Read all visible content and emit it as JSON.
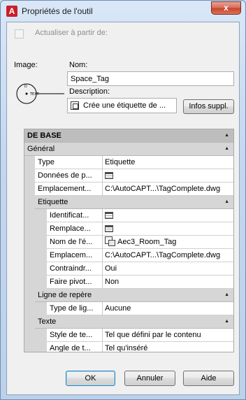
{
  "window": {
    "title": "Propriétés de l'outil",
    "app_icon_letter": "A",
    "close_glyph": "x"
  },
  "options": {
    "update_from_label": "Actualiser à partir de:",
    "update_from_checked": false
  },
  "image": {
    "label": "Image:",
    "preview_tag_letter": "D",
    "preview_text": "TEXT"
  },
  "name": {
    "label": "Nom:",
    "value": "Space_Tag"
  },
  "description": {
    "label": "Description:",
    "value": "Crée une étiquette de ..."
  },
  "buttons": {
    "infos": "Infos suppl.",
    "ok": "OK",
    "cancel": "Annuler",
    "help": "Aide"
  },
  "grid": {
    "section": "DE BASE",
    "collapse_glyph": "▲",
    "general": {
      "label": "Général",
      "rows": [
        {
          "key": "Type",
          "value": "Etiquette"
        },
        {
          "key": "Données de p...",
          "value": "",
          "icon": "calendar-icon"
        },
        {
          "key": "Emplacement...",
          "value": "C:\\AutoCAPT...\\TagComplete.dwg"
        }
      ]
    },
    "etiquette": {
      "label": "Etiquette",
      "rows": [
        {
          "key": "Identificat...",
          "value": "",
          "icon": "calendar-icon"
        },
        {
          "key": "Remplace...",
          "value": "",
          "icon": "calendar-icon"
        },
        {
          "key": "Nom de l'é...",
          "value": "Aec3_Room_Tag",
          "icon": "tag-style-icon"
        },
        {
          "key": "Emplacem...",
          "value": "C:\\AutoCAPT...\\TagComplete.dwg"
        },
        {
          "key": "Contraindr...",
          "value": "Oui"
        },
        {
          "key": "Faire pivot...",
          "value": "Non"
        }
      ]
    },
    "leader": {
      "label": "Ligne de repère",
      "rows": [
        {
          "key": "Type de lig...",
          "value": "Aucune"
        }
      ]
    },
    "text": {
      "label": "Texte",
      "rows": [
        {
          "key": "Style de te...",
          "value": "Tel que défini par le contenu"
        },
        {
          "key": "Angle de t...",
          "value": "Tel qu'inséré"
        }
      ]
    }
  }
}
